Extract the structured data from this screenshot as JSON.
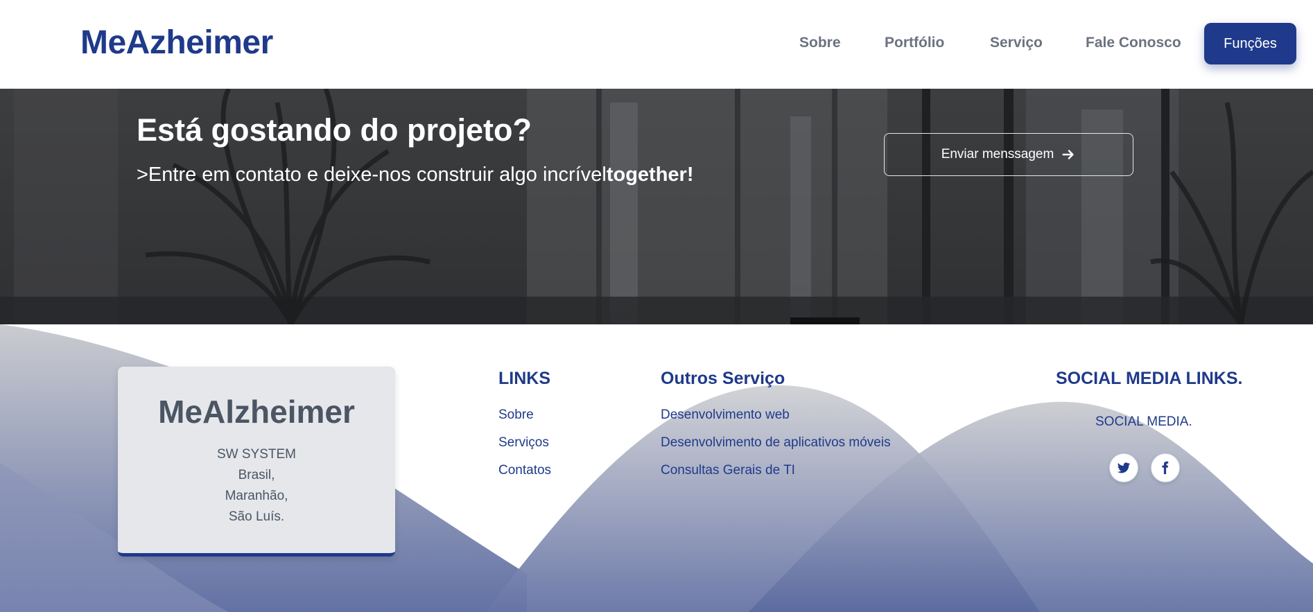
{
  "header": {
    "brand": "MeAzheimer",
    "nav": [
      "Sobre",
      "Portfólio",
      "Serviço",
      "Fale Conosco"
    ],
    "cta_label": "Funções"
  },
  "hero": {
    "title": "Está gostando do projeto?",
    "subtitle_text": ">Entre em contato e deixe-nos construir algo incrível",
    "subtitle_bold": "together!",
    "button_label": "Enviar menssagem"
  },
  "footer": {
    "card": {
      "title": "MeAlzheimer",
      "lines": [
        "SW SYSTEM",
        "Brasil,",
        "Maranhão,",
        "São Luís."
      ]
    },
    "links": {
      "title": "LINKS",
      "items": [
        "Sobre",
        "Serviços",
        "Contatos"
      ]
    },
    "services": {
      "title": "Outros Serviço",
      "items": [
        "Desenvolvimento web",
        "Desenvolvimento de aplicativos móveis",
        "Consultas Gerais de TI"
      ]
    },
    "social": {
      "title": "SOCIAL MEDIA LINKS.",
      "subtitle": "SOCIAL MEDIA.",
      "icons": [
        "twitter-icon",
        "facebook-icon"
      ]
    }
  },
  "colors": {
    "brand": "#1f3a8a",
    "nav_text": "#6b7280",
    "card_bg": "#e5e7eb",
    "wave_top": "#c8c9ce",
    "wave_bottom": "#5a6aa0"
  }
}
